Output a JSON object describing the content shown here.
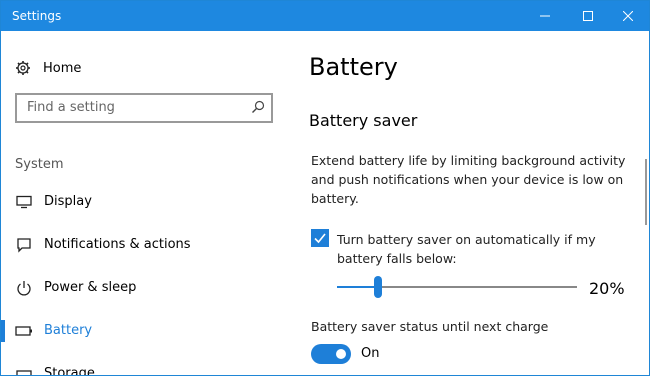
{
  "window": {
    "title": "Settings"
  },
  "sidebar": {
    "home_label": "Home",
    "search_placeholder": "Find a setting",
    "section_header": "System",
    "items": [
      {
        "label": "Display",
        "icon": "monitor-icon"
      },
      {
        "label": "Notifications & actions",
        "icon": "notification-icon"
      },
      {
        "label": "Power & sleep",
        "icon": "power-icon"
      },
      {
        "label": "Battery",
        "icon": "battery-icon",
        "active": true
      },
      {
        "label": "Storage",
        "icon": "storage-icon"
      }
    ]
  },
  "main": {
    "title": "Battery",
    "subtitle": "Battery saver",
    "description": "Extend battery life by limiting background activity and push notifications when your device is low on battery.",
    "auto_checkbox": {
      "label": "Turn battery saver on automatically if my battery falls below:",
      "checked": true
    },
    "threshold": {
      "value_percent": 20,
      "value_label": "20%",
      "slider_fraction": 0.17
    },
    "status_label": "Battery saver status until next charge",
    "status_toggle": {
      "on": true,
      "state_label": "On"
    }
  },
  "colors": {
    "accent": "#1e7fd8",
    "titlebar": "#1e88e0"
  }
}
